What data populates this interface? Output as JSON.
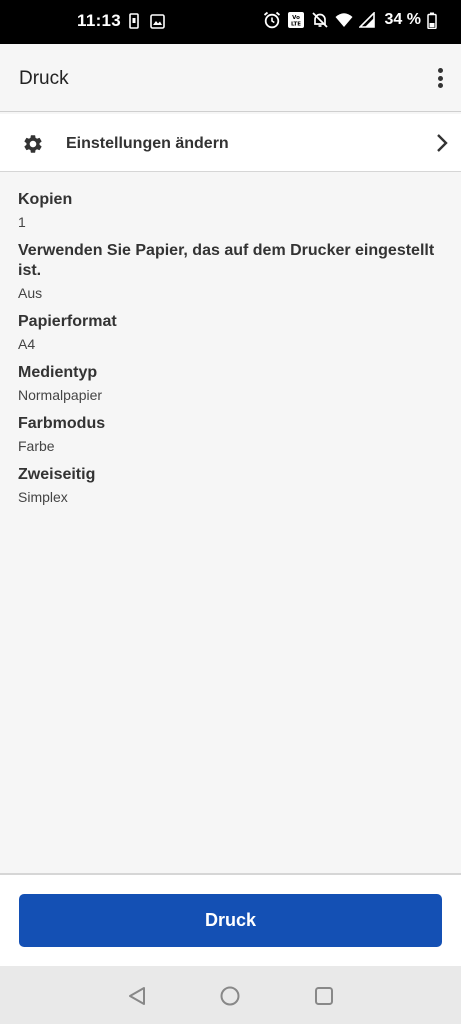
{
  "status_bar": {
    "time": "11:13",
    "battery": "34 %",
    "icons_left": [
      "sim-icon",
      "image-icon"
    ],
    "icons_right": [
      "alarm-icon",
      "volte-icon",
      "mute-icon",
      "wifi-icon",
      "signal-icon",
      "battery-icon"
    ]
  },
  "app_bar": {
    "title": "Druck",
    "menu_icon": "more-vert-icon"
  },
  "settings_row": {
    "label": "Einstellungen ändern",
    "icon": "gear-icon",
    "trailing_icon": "chevron-right-icon"
  },
  "options": [
    {
      "title": "Kopien",
      "value": "1"
    },
    {
      "title": "Verwenden Sie Papier, das auf dem Drucker eingestellt ist.",
      "value": "Aus"
    },
    {
      "title": "Papierformat",
      "value": "A4"
    },
    {
      "title": "Medientyp",
      "value": "Normalpapier"
    },
    {
      "title": "Farbmodus",
      "value": "Farbe"
    },
    {
      "title": "Zweiseitig",
      "value": "Simplex"
    }
  ],
  "print_button": {
    "label": "Druck"
  },
  "nav_bar": {
    "buttons": [
      "back-icon",
      "home-icon",
      "recents-icon"
    ]
  },
  "colors": {
    "accent": "#1450b4",
    "background": "#f6f6f6"
  }
}
